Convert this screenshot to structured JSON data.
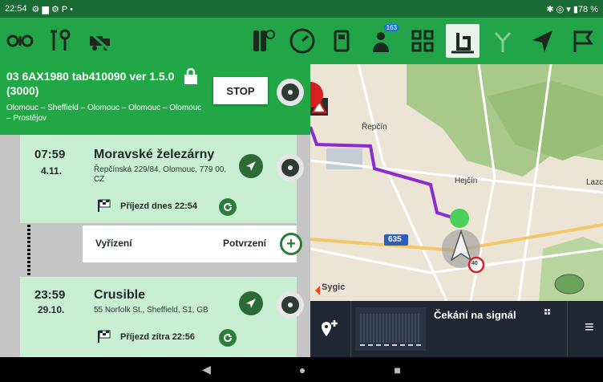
{
  "status": {
    "time": "22:54",
    "left_icons": "⚙ ▆ ⚙ P •",
    "right_text": "✱ ◎ ▾ ▮78 %"
  },
  "toolbar": {
    "badge": "163",
    "icons": [
      "drone-icon",
      "tools-icon",
      "truck-off-icon",
      "tire-icon",
      "speedometer-icon",
      "fuel-icon",
      "person-hand-icon",
      "grid-icon",
      "road-sign-icon",
      "split-arrow-icon",
      "navigate-arrow-icon",
      "flag-icon"
    ]
  },
  "trip": {
    "title": "03 6AX1980 tab410090 ver 1.5.0 (3000)",
    "route": "Olomouc – Sheffield – Olomouc – Olomouc – Olomouc – Prostějov",
    "stop_label": "STOP"
  },
  "stops": [
    {
      "time": "07:59",
      "date": "4.11.",
      "name": "Moravské železárny",
      "address": "Řepčínská 229/84, Olomouc, 779 00, CZ",
      "arrival": "Příjezd dnes 22:54"
    },
    {
      "time": "23:59",
      "date": "29.10.",
      "name": "Crusible",
      "address": "55 Norfolk St., Sheffield, S1, GB",
      "arrival": "Příjezd zítra 22:56"
    }
  ],
  "action": {
    "left": "Vyřízení",
    "right": "Potvrzení",
    "plus": "+"
  },
  "map": {
    "labels": [
      "Řepčín",
      "Hejčín",
      "Lazc"
    ],
    "road_number": "635",
    "brand": "Sygic",
    "speed_limit": "40"
  },
  "nav": {
    "signal_text": "Čekání na signál",
    "menu": "≡"
  },
  "android": {
    "back": "◀",
    "home": "●",
    "recent": "■"
  }
}
